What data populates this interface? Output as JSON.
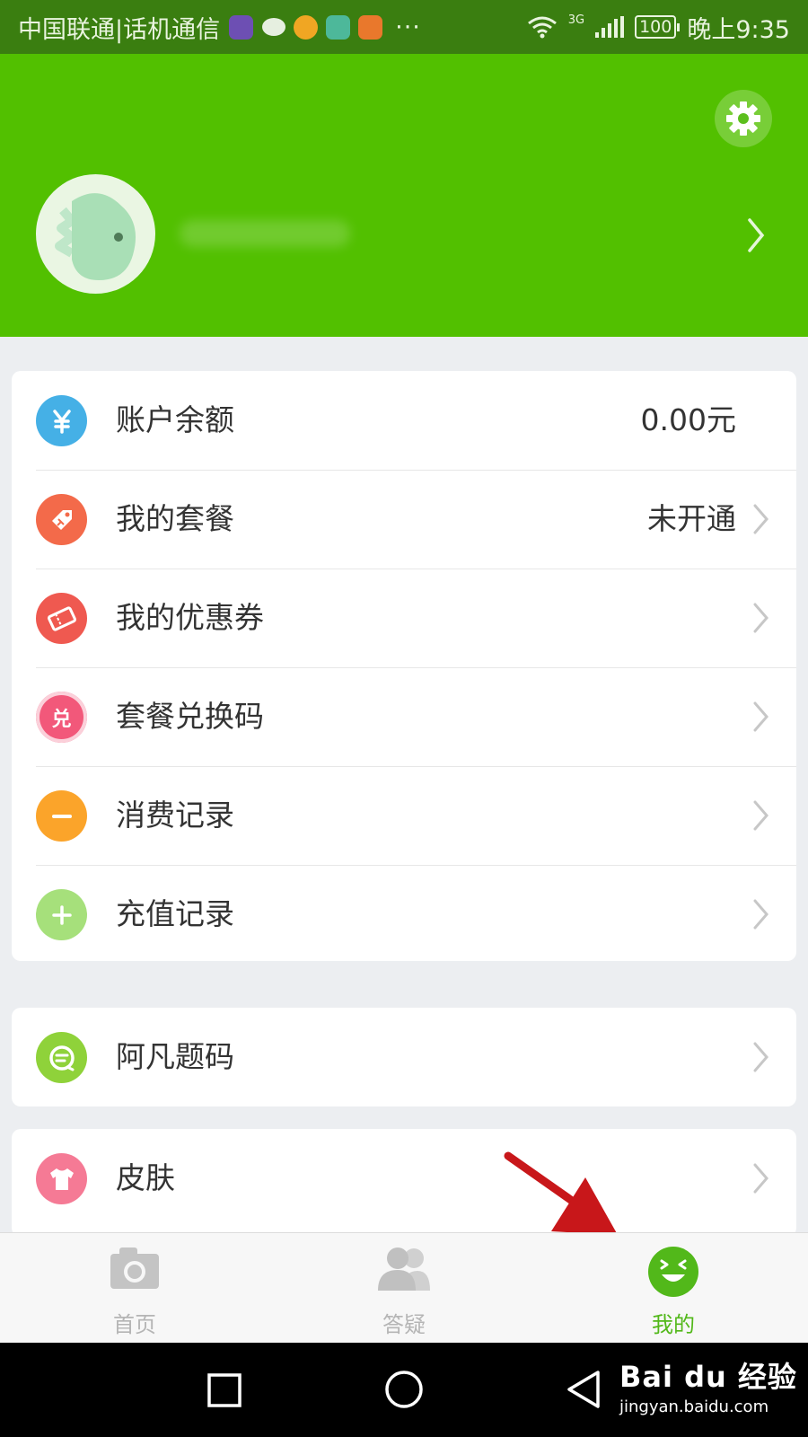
{
  "status_bar": {
    "carrier": "中国联通|话机通信",
    "more": "···",
    "network": "3G",
    "battery": "100",
    "time": "晚上9:35"
  },
  "profile": {
    "settings_icon": "gear-icon",
    "chevron_icon": "chevron-right-icon",
    "header_color": "#52c000"
  },
  "account_card": {
    "items": [
      {
        "label": "账户余额",
        "value": "0.00元",
        "icon": "yen-icon",
        "color": "#45b0e6"
      },
      {
        "label": "我的套餐",
        "value": "未开通",
        "icon": "tag-icon",
        "color": "#f36a4a"
      },
      {
        "label": "我的优惠券",
        "icon": "coupon-icon",
        "color": "#ef5950"
      },
      {
        "label": "套餐兑换码",
        "icon": "redeem-icon",
        "icon_text": "兑",
        "color": "#f2587a"
      },
      {
        "label": "消费记录",
        "icon": "minus-icon",
        "color": "#fba42a"
      },
      {
        "label": "充值记录",
        "icon": "plus-icon",
        "color": "#a6e07b"
      }
    ]
  },
  "tools_card": {
    "items": [
      {
        "label": "阿凡题码",
        "icon": "chat-code-icon",
        "color": "#8fd23a"
      }
    ]
  },
  "skin_card": {
    "items": [
      {
        "label": "皮肤",
        "icon": "tshirt-icon",
        "color": "#f57a95"
      }
    ]
  },
  "tab_bar": {
    "tabs": [
      {
        "label": "首页",
        "icon": "camera-icon",
        "active": false
      },
      {
        "label": "答疑",
        "icon": "users-icon",
        "active": false
      },
      {
        "label": "我的",
        "icon": "smiley-icon",
        "active": true
      }
    ],
    "active_color": "#52b81a"
  },
  "watermark": {
    "logo": "Bai du 经验",
    "url": "jingyan.baidu.com"
  }
}
